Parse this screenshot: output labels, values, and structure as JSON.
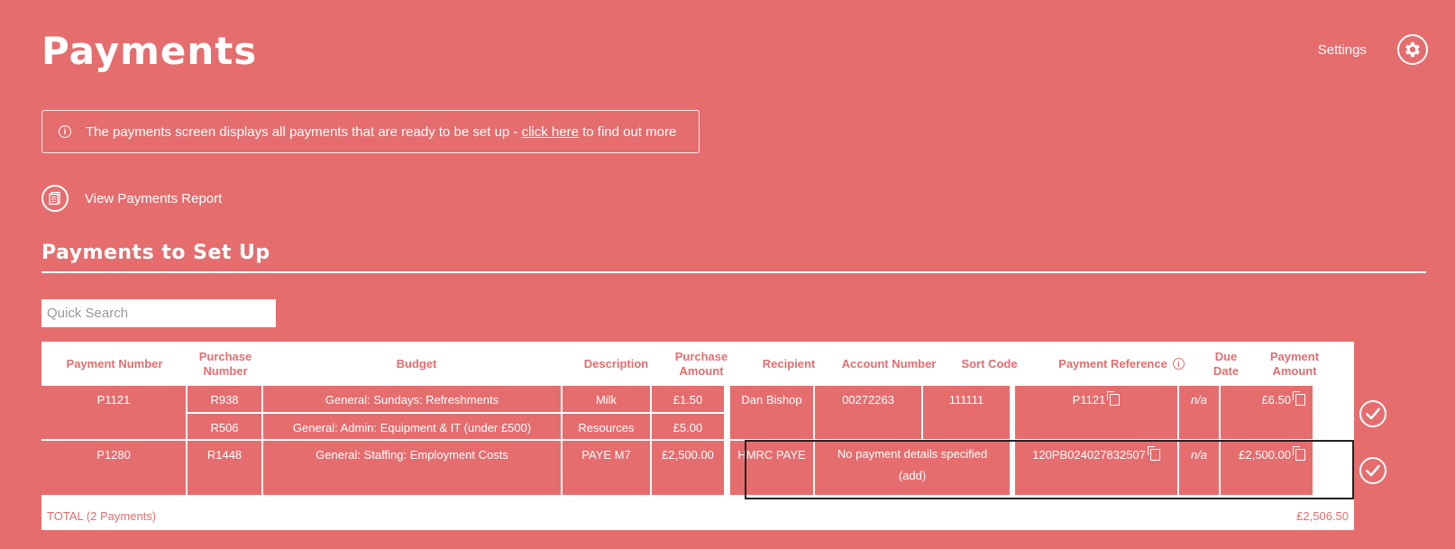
{
  "header": {
    "title": "Payments",
    "settings_label": "Settings",
    "settings_icon": "gear-icon"
  },
  "info": {
    "text_before": "The payments screen displays all payments that are ready to be set up - ",
    "link_text": "click here",
    "text_after": " to find out more"
  },
  "report": {
    "label": "View Payments Report"
  },
  "section": {
    "title": "Payments to Set Up"
  },
  "search": {
    "placeholder": "Quick Search"
  },
  "table": {
    "headers": {
      "payment_number": "Payment Number",
      "purchase_number": "Purchase Number",
      "budget": "Budget",
      "description": "Description",
      "purchase_amount": "Purchase Amount",
      "recipient": "Recipient",
      "account_number": "Account Number",
      "sort_code": "Sort Code",
      "payment_reference": "Payment Reference",
      "due_date": "Due Date",
      "payment_amount": "Payment Amount"
    },
    "payments": [
      {
        "payment_number": "P1121",
        "purchases": [
          {
            "purchase_number": "R938",
            "budget": "General: Sundays: Refreshments",
            "description": "Milk",
            "amount": "£1.50"
          },
          {
            "purchase_number": "R506",
            "budget": "General: Admin: Equipment & IT (under £500)",
            "description": "Resources",
            "amount": "£5.00"
          }
        ],
        "recipient": "Dan Bishop",
        "account_number": "00272263",
        "sort_code": "111111",
        "payment_reference": "P1121",
        "due_date": "n/a",
        "payment_amount": "£6.50"
      },
      {
        "payment_number": "P1280",
        "purchases": [
          {
            "purchase_number": "R1448",
            "budget": "General: Staffing: Employment Costs",
            "description": "PAYE M7",
            "amount": "£2,500.00"
          }
        ],
        "recipient": "HMRC PAYE",
        "no_details": "No payment details specified",
        "add_label": "(add)",
        "payment_reference": "120PB024027832507",
        "due_date": "n/a",
        "payment_amount": "£2,500.00"
      }
    ],
    "total_label": "TOTAL (2 Payments)",
    "total_value": "£2,506.50"
  }
}
